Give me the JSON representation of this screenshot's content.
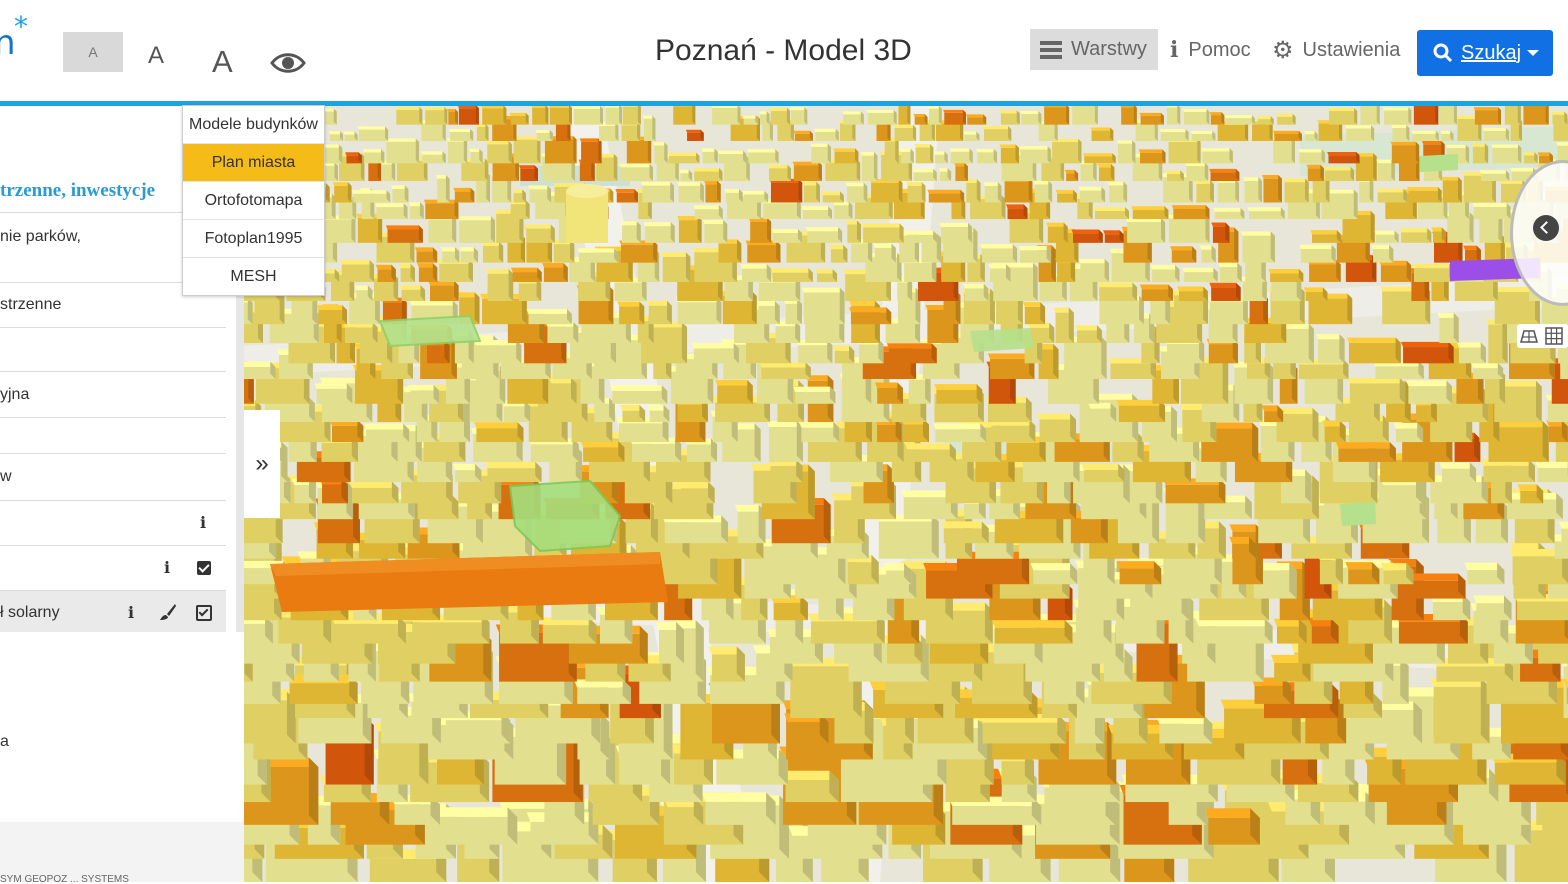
{
  "header": {
    "title": "Poznań - Model 3D",
    "font_small": "A",
    "font_medium": "A",
    "font_large": "A",
    "layers_label": "Warstwy",
    "help_label": "Pomoc",
    "settings_label": "Ustawienia",
    "search_label": "Szukaj",
    "accent_color": "#1ba3e2",
    "search_button_color": "#1170e3"
  },
  "base_layers": {
    "items": [
      "Modele budynków",
      "Plan miasta",
      "Ortofotomapa",
      "Fotoplan1995",
      "MESH"
    ],
    "active": "Plan miasta",
    "active_color": "#f5bb18"
  },
  "panel": {
    "section_title": "trzenne, inwestycje",
    "items": [
      {
        "label": "nie parków,"
      },
      {
        "label": "strzenne"
      },
      {
        "label": "yjna"
      },
      {
        "label": "w"
      },
      {
        "label": ""
      },
      {
        "label": ""
      },
      {
        "label": "ł solarny"
      },
      {
        "label": "a"
      }
    ],
    "section_color": "#2a9ad6"
  },
  "attribution": "SYM GEOPOZ ... SYSTEMS",
  "icons": {
    "layers": "hamburger-icon",
    "help": "info-icon",
    "settings": "gear-icon",
    "search": "search-icon",
    "accessibility": "eye-icon",
    "collapse": "double-chevron-right-icon",
    "compass": "chevron-left-icon"
  },
  "building_colors": [
    "#f6f29a",
    "#f3e16a",
    "#f2c538",
    "#f0a31e",
    "#ea7b10",
    "#e35d0c",
    "#9ad96b",
    "#9b4fe8"
  ]
}
